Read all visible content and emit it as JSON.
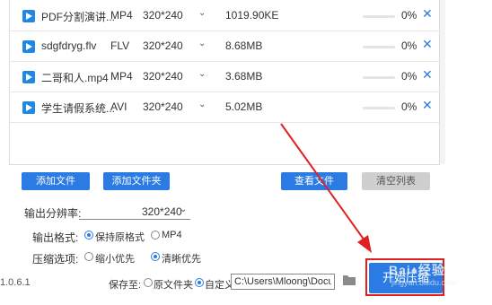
{
  "files": [
    {
      "name": "PDF分割演讲...",
      "format": "MP4",
      "resolution": "320*240",
      "size": "1019.90KE",
      "progress": 0,
      "progress_text": "0%"
    },
    {
      "name": "sdgfdryg.flv",
      "format": "FLV",
      "resolution": "320*240",
      "size": "8.68MB",
      "progress": 0,
      "progress_text": "0%"
    },
    {
      "name": "二哥和人.mp4",
      "format": "MP4",
      "resolution": "320*240",
      "size": "3.68MB",
      "progress": 0,
      "progress_text": "0%"
    },
    {
      "name": "学生请假系统...",
      "format": "AVI",
      "resolution": "320*240",
      "size": "5.02MB",
      "progress": 0,
      "progress_text": "0%"
    }
  ],
  "toolbar": {
    "add_file": "添加文件",
    "add_folder": "添加文件夹",
    "view_file": "查看文件",
    "clear_list": "清空列表"
  },
  "settings": {
    "resolution_label": "输出分辨率:",
    "resolution_value": "320*240",
    "format_label": "输出格式:",
    "format_options": [
      "保持原格式",
      "MP4"
    ],
    "format_selected": "保持原格式",
    "compress_label": "压缩选项:",
    "compress_options": [
      "缩小优先",
      "清晰优先"
    ],
    "compress_selected": "清晰优先"
  },
  "bottom": {
    "version": "1.0.6.1",
    "save_to_label": "保存至:",
    "save_options": [
      "原文件夹",
      "自定义"
    ],
    "save_selected": "自定义",
    "path_value": "C:\\Users\\Mloong\\Docume",
    "start_label": "开始压缩"
  },
  "colors": {
    "accent": "#2a7be4",
    "annotation_red": "#e02020"
  },
  "icons": {
    "file": "play-file-icon",
    "remove": "close-icon",
    "dropdown": "chevron-down-icon",
    "folder": "folder-icon"
  }
}
